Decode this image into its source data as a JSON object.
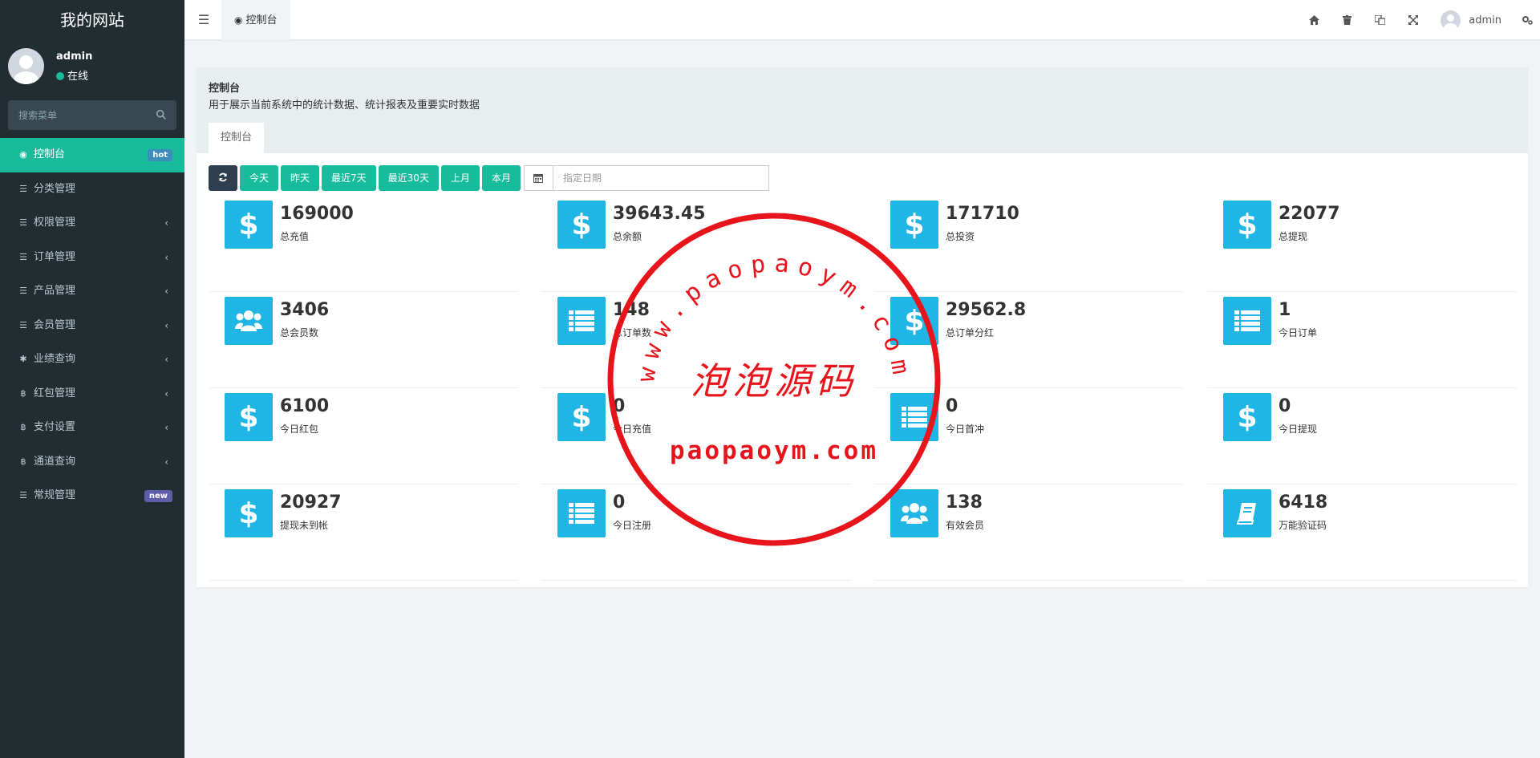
{
  "sidebar": {
    "site_title": "我的网站",
    "user": {
      "name": "admin",
      "status": "在线"
    },
    "search_placeholder": "搜索菜单",
    "items": [
      {
        "label": "控制台",
        "icon": "dashboard-icon",
        "badge": "hot",
        "active": true
      },
      {
        "label": "分类管理",
        "icon": "list-icon"
      },
      {
        "label": "权限管理",
        "icon": "list-icon",
        "expandable": true
      },
      {
        "label": "订单管理",
        "icon": "list-icon",
        "expandable": true
      },
      {
        "label": "产品管理",
        "icon": "list-icon",
        "expandable": true
      },
      {
        "label": "会员管理",
        "icon": "list-icon",
        "expandable": true
      },
      {
        "label": "业绩查询",
        "icon": "asterisk-icon",
        "expandable": true
      },
      {
        "label": "红包管理",
        "icon": "bitcoin-icon",
        "expandable": true
      },
      {
        "label": "支付设置",
        "icon": "bitcoin-icon",
        "expandable": true
      },
      {
        "label": "通道查询",
        "icon": "bitcoin-icon",
        "expandable": true
      },
      {
        "label": "常规管理",
        "icon": "list-icon",
        "badge": "new"
      }
    ]
  },
  "header": {
    "tab_label": "控制台",
    "username": "admin",
    "icons": [
      "home-icon",
      "trash-icon",
      "language-icon",
      "fullscreen-icon",
      "settings-icon"
    ]
  },
  "panel": {
    "title": "控制台",
    "description": "用于展示当前系统中的统计数据、统计报表及重要实时数据",
    "tab": "控制台"
  },
  "toolbar": {
    "buttons": [
      "今天",
      "昨天",
      "最近7天",
      "最近30天",
      "上月",
      "本月"
    ],
    "date_placeholder": "指定日期"
  },
  "stats": [
    {
      "value": "169000",
      "label": "总充值",
      "icon": "dollar-icon"
    },
    {
      "value": "39643.45",
      "label": "总余额",
      "icon": "dollar-icon"
    },
    {
      "value": "171710",
      "label": "总投资",
      "icon": "dollar-icon"
    },
    {
      "value": "22077",
      "label": "总提现",
      "icon": "dollar-icon"
    },
    {
      "value": "3406",
      "label": "总会员数",
      "icon": "users-icon"
    },
    {
      "value": "148",
      "label": "总订单数",
      "icon": "list-icon"
    },
    {
      "value": "29562.8",
      "label": "总订单分红",
      "icon": "dollar-icon"
    },
    {
      "value": "1",
      "label": "今日订单",
      "icon": "list-icon"
    },
    {
      "value": "6100",
      "label": "今日红包",
      "icon": "dollar-icon"
    },
    {
      "value": "0",
      "label": "今日充值",
      "icon": "dollar-icon"
    },
    {
      "value": "0",
      "label": "今日首冲",
      "icon": "list-icon"
    },
    {
      "value": "0",
      "label": "今日提现",
      "icon": "dollar-icon"
    },
    {
      "value": "20927",
      "label": "提现未到帐",
      "icon": "dollar-icon"
    },
    {
      "value": "0",
      "label": "今日注册",
      "icon": "list-icon"
    },
    {
      "value": "138",
      "label": "有效会员",
      "icon": "users-icon"
    },
    {
      "value": "6418",
      "label": "万能验证码",
      "icon": "book-icon"
    }
  ],
  "watermark": {
    "arc_text": "www.paopaoym.com",
    "center_text": "泡泡源码",
    "bottom_text": "paopaoym.com",
    "color": "#e8141c"
  },
  "colors": {
    "accent": "#18bc9c",
    "sidebar": "#222d32",
    "stat_icon": "#1fb5e5"
  }
}
